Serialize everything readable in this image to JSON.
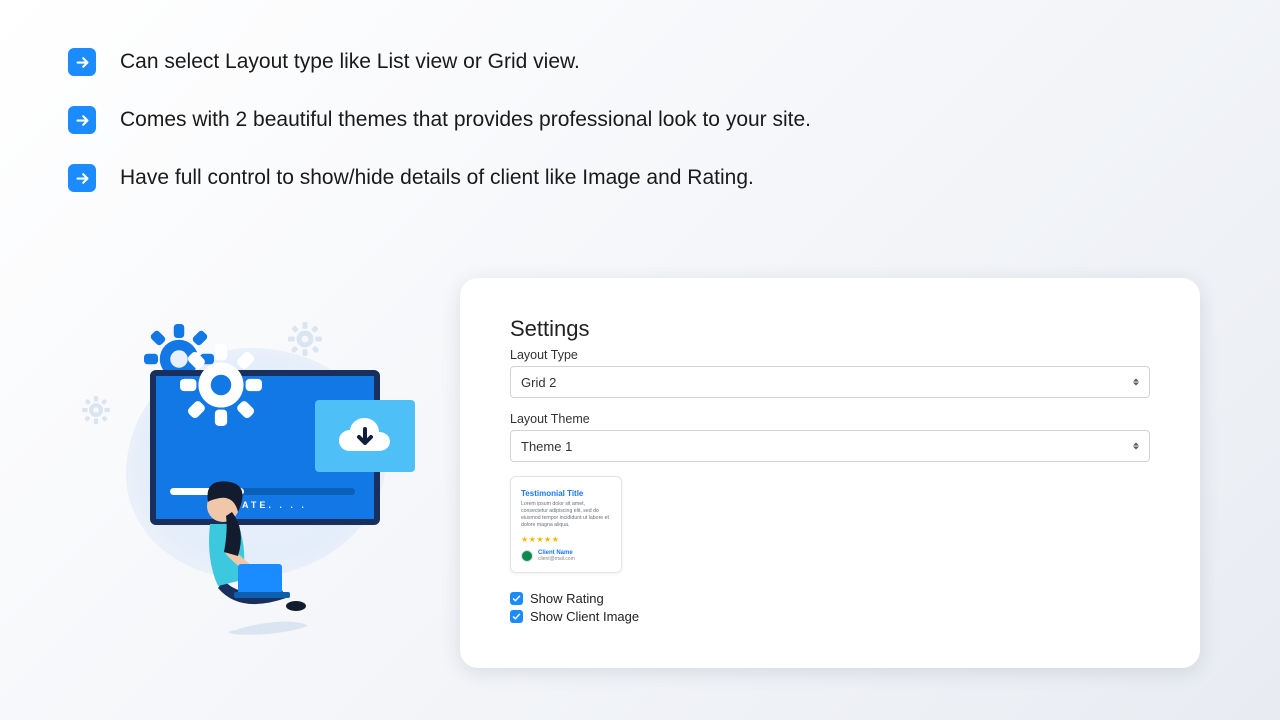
{
  "features": {
    "items": [
      {
        "text": "Can select Layout type like List view or Grid view."
      },
      {
        "text": "Comes with 2 beautiful themes that provides professional look to your site."
      },
      {
        "text": "Have full control to show/hide details of client like Image and Rating."
      }
    ]
  },
  "illustration": {
    "update_label": "UPDATE. . . ."
  },
  "settings": {
    "title": "Settings",
    "layout_type": {
      "label": "Layout Type",
      "value": "Grid 2"
    },
    "layout_theme": {
      "label": "Layout Theme",
      "value": "Theme 1"
    },
    "preview": {
      "title": "Testimonial Title",
      "body": "Lorem ipsum dolor sit amet, consectetur adipiscing elit, sed do eiusmod tempor incididunt ut labore et dolore magna aliqua.",
      "stars": "★★★★★",
      "client_name": "Client Name",
      "client_email": "client@mail.com"
    },
    "options": {
      "show_rating": {
        "label": "Show Rating",
        "checked": true
      },
      "show_client_image": {
        "label": "Show Client Image",
        "checked": true
      }
    }
  },
  "colors": {
    "accent": "#1a8cff",
    "monitor": "#1278e6",
    "monitor_border": "#192f5d",
    "download_card": "#4fbff8",
    "star": "#f7b500"
  }
}
